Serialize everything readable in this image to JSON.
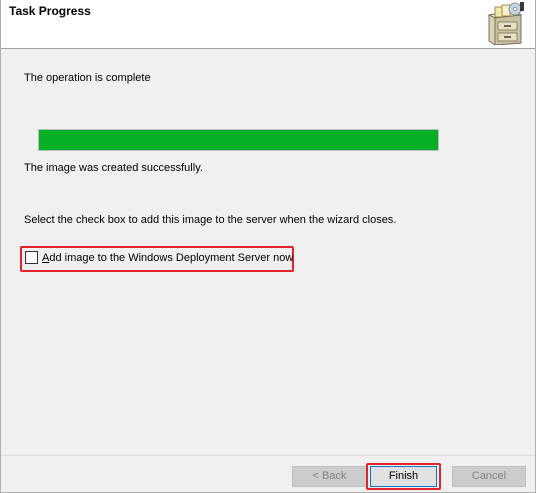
{
  "header": {
    "title": "Task Progress",
    "icon": "file-cabinet-icon"
  },
  "main": {
    "status_heading": "The operation is complete",
    "progress": {
      "percent": 100,
      "color": "#06b025"
    },
    "result_text": "The image was created successfully.",
    "instruction_text": "Select the check box to add this image to the server when the wizard closes.",
    "checkbox": {
      "label_mnemonic": "A",
      "label_rest": "dd image to the Windows Deployment Server now",
      "checked": false
    }
  },
  "footer": {
    "back_label": "< Back",
    "finish_label": "Finish",
    "cancel_label": "Cancel"
  },
  "highlight_color": "#e8202a"
}
